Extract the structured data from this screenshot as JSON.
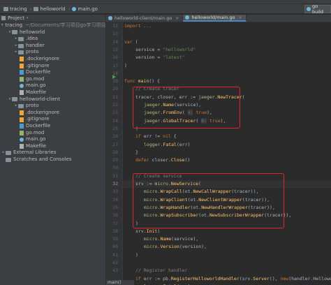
{
  "breadcrumb": {
    "items": [
      "tracing",
      "helloworld",
      "main.go"
    ],
    "run_config": "go build"
  },
  "project_panel": {
    "title": "Project",
    "tree": [
      {
        "indent": 0,
        "arrow": "▾",
        "kind": "folder-root",
        "label": "tracing",
        "path": "~/Documents/学习项目go学习项目/tracing"
      },
      {
        "indent": 1,
        "arrow": "▾",
        "kind": "folder",
        "label": "helloworld",
        "path": ""
      },
      {
        "indent": 2,
        "arrow": "▸",
        "kind": "folder",
        "label": ".idea",
        "path": ""
      },
      {
        "indent": 2,
        "arrow": "▸",
        "kind": "folder",
        "label": "handler",
        "path": ""
      },
      {
        "indent": 2,
        "arrow": "▸",
        "kind": "folder",
        "label": "proto",
        "path": ""
      },
      {
        "indent": 2,
        "arrow": "",
        "kind": "git",
        "label": ".dockerignore",
        "path": ""
      },
      {
        "indent": 2,
        "arrow": "",
        "kind": "git",
        "label": ".gitignore",
        "path": ""
      },
      {
        "indent": 2,
        "arrow": "",
        "kind": "docker",
        "label": "Dockerfile",
        "path": ""
      },
      {
        "indent": 2,
        "arrow": "",
        "kind": "mod",
        "label": "go.mod",
        "path": ""
      },
      {
        "indent": 2,
        "arrow": "",
        "kind": "go",
        "label": "main.go",
        "path": ""
      },
      {
        "indent": 2,
        "arrow": "",
        "kind": "make",
        "label": "Makefile",
        "path": ""
      },
      {
        "indent": 1,
        "arrow": "▾",
        "kind": "folder",
        "label": "helloworld-client",
        "path": ""
      },
      {
        "indent": 2,
        "arrow": "▸",
        "kind": "folder",
        "label": "proto",
        "path": ""
      },
      {
        "indent": 2,
        "arrow": "",
        "kind": "git",
        "label": ".dockerignore",
        "path": ""
      },
      {
        "indent": 2,
        "arrow": "",
        "kind": "git",
        "label": ".gitignore",
        "path": ""
      },
      {
        "indent": 2,
        "arrow": "",
        "kind": "docker",
        "label": "Dockerfile",
        "path": ""
      },
      {
        "indent": 2,
        "arrow": "",
        "kind": "mod",
        "label": "go.mod",
        "path": ""
      },
      {
        "indent": 2,
        "arrow": "",
        "kind": "go",
        "label": "main.go",
        "path": ""
      },
      {
        "indent": 2,
        "arrow": "",
        "kind": "make",
        "label": "Makefile",
        "path": ""
      },
      {
        "indent": 0,
        "arrow": "▸",
        "kind": "folder",
        "label": "External Libraries",
        "path": ""
      },
      {
        "indent": 0,
        "arrow": "",
        "kind": "folder",
        "label": "Scratches and Consoles",
        "path": ""
      }
    ]
  },
  "tabs": [
    {
      "label": "helloworld-client/main.go",
      "active": false
    },
    {
      "label": "helloworld/main.go",
      "active": true
    }
  ],
  "line_numbers": [
    "12",
    "13",
    "14",
    "15",
    "16",
    "17",
    "18",
    "19",
    "20",
    "21",
    "22",
    "23",
    "24",
    "25",
    "26",
    "27",
    "28",
    "29",
    "30",
    "31",
    "32",
    "33",
    "34",
    "35",
    "36",
    "37",
    "38",
    "39",
    "40",
    "41",
    "42",
    "43"
  ],
  "current_line": "32",
  "status_label": "main()",
  "colors": {
    "highlight_box": "#e0262a",
    "keyword": "#cc7832",
    "string": "#6a8759",
    "function": "#ffc66d",
    "comment": "#808080"
  }
}
